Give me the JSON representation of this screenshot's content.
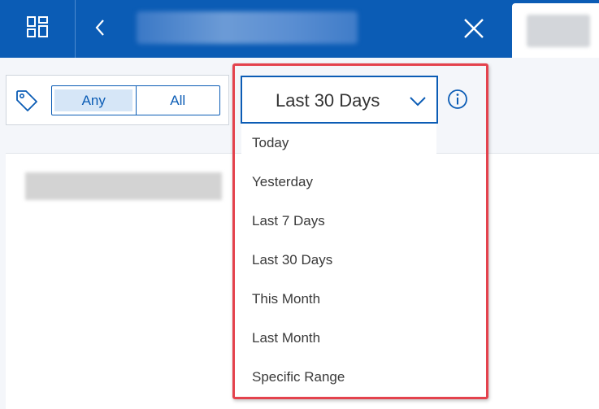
{
  "colors": {
    "brand": "#0b5cb5",
    "highlight": "#e4424d"
  },
  "header": {
    "apps_icon": "grid-layout-icon",
    "back_icon": "chevron-left-icon",
    "close_icon": "close-icon"
  },
  "tag_filter": {
    "icon": "tag-icon",
    "options": [
      "Any",
      "All"
    ],
    "selected": "Any"
  },
  "date_filter": {
    "selected": "Last 30 Days",
    "chevron_icon": "chevron-down-icon",
    "info_icon": "info-icon",
    "options": [
      "Today",
      "Yesterday",
      "Last 7 Days",
      "Last 30 Days",
      "This Month",
      "Last Month",
      "Specific Range"
    ]
  }
}
